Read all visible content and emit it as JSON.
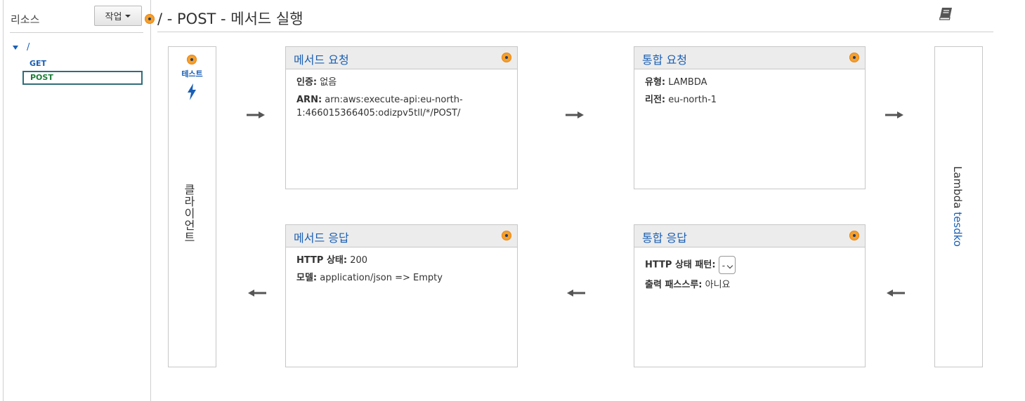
{
  "sidebar": {
    "title": "리소스",
    "action_button": "작업",
    "tree": {
      "root": "/",
      "get": "GET",
      "post": "POST"
    }
  },
  "header": {
    "title": "/ - POST - 메서드 실행"
  },
  "client": {
    "test_label": "테스트",
    "label": "클라이언트"
  },
  "method_request": {
    "title": "메서드 요청",
    "auth_label": "인증:",
    "auth_value": "없음",
    "arn_label": "ARN:",
    "arn_value": "arn:aws:execute-api:eu-north-1:466015366405:odizpv5tll/*/POST/"
  },
  "integration_request": {
    "title": "통합 요청",
    "type_label": "유형:",
    "type_value": "LAMBDA",
    "region_label": "리전:",
    "region_value": "eu-north-1"
  },
  "method_response": {
    "title": "메서드 응답",
    "status_label": "HTTP 상태:",
    "status_value": "200",
    "model_label": "모델:",
    "model_value": "application/json => Empty"
  },
  "integration_response": {
    "title": "통합 응답",
    "pattern_label": "HTTP 상태 패턴:",
    "pattern_value": "-",
    "passthrough_label": "출력 패스스루:",
    "passthrough_value": "아니요"
  },
  "lambda": {
    "prefix": "Lambda",
    "function_name": "tesdko"
  },
  "icons": {
    "status_dot": "info-dot-icon",
    "book": "book-icon",
    "bolt": "lightning-bolt-icon",
    "arrow_right": "arrow-right-icon",
    "arrow_left": "arrow-left-icon"
  },
  "colors": {
    "link": "#1a5fb4",
    "dot": "#f6a02b",
    "selected_border": "#2f6d7a",
    "post_text": "#1a7f37",
    "panel_header_bg": "#ececec"
  }
}
